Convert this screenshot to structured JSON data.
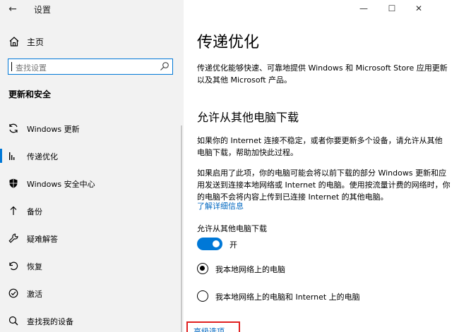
{
  "app": {
    "title": "设置"
  },
  "window_controls": {
    "minimize": "—",
    "maximize": "☐",
    "close": "✕"
  },
  "sidebar": {
    "home_label": "主页",
    "search": {
      "placeholder": "查找设置"
    },
    "section_title": "更新和安全",
    "items": [
      {
        "label": "Windows 更新",
        "icon": "sync-icon",
        "active": false
      },
      {
        "label": "传递优化",
        "icon": "delivery-optimization-icon",
        "active": true
      },
      {
        "label": "Windows 安全中心",
        "icon": "shield-icon",
        "active": false
      },
      {
        "label": "备份",
        "icon": "backup-icon",
        "active": false
      },
      {
        "label": "疑难解答",
        "icon": "wrench-icon",
        "active": false
      },
      {
        "label": "恢复",
        "icon": "recovery-icon",
        "active": false
      },
      {
        "label": "激活",
        "icon": "activation-icon",
        "active": false
      },
      {
        "label": "查找我的设备",
        "icon": "find-device-icon",
        "active": false
      }
    ]
  },
  "main": {
    "title": "传递优化",
    "description": "传递优化能够快速、可靠地提供 Windows 和 Microsoft Store 应用更新以及其他 Microsoft 产品。",
    "subheading": "允许从其他电脑下载",
    "para1": "如果你的 Internet 连接不稳定，或者你要更新多个设备，请允许从其他电脑下载，帮助加快此过程。",
    "para2": "如果启用了此项，你的电脑可能会将以前下载的部分 Windows 更新和应用发送到连接本地网络或 Internet 的电脑。使用按流量计费的网络时，你的电脑不会将内容上传到已连接 Internet 的其他电脑。",
    "learn_more": "了解详细信息",
    "toggle_label": "允许从其他电脑下载",
    "toggle_state": "开",
    "toggle_on": true,
    "radio_options": [
      {
        "label": "我本地网络上的电脑",
        "selected": true
      },
      {
        "label": "我本地网络上的电脑和 Internet 上的电脑",
        "selected": false
      }
    ],
    "advanced_link": "高级选项"
  },
  "colors": {
    "accent": "#0078d7",
    "link": "#0067c0",
    "highlight_box": "#e02020",
    "sidebar_bg": "#f2f2f2"
  }
}
